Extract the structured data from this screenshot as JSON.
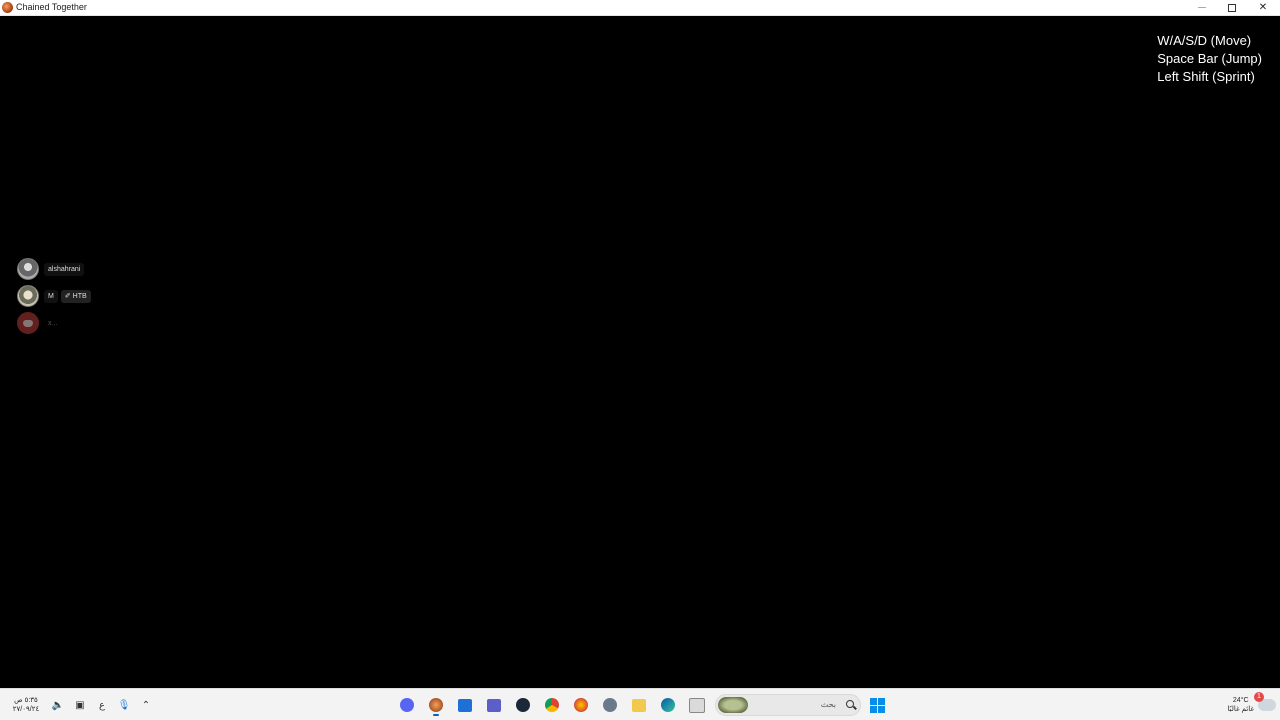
{
  "window": {
    "title": "Chained Together",
    "app_icon": "chained-together-icon"
  },
  "controls_hint": {
    "lines": [
      "W/A/S/D (Move)",
      "Space Bar (Jump)",
      "Left Shift (Sprint)"
    ],
    "color": "#ffffff"
  },
  "voice_overlay": {
    "users": [
      {
        "name": "alshahrani",
        "avatar": "user-avatar"
      },
      {
        "name": "M",
        "tag": "✐ HTB",
        "avatar": "user-avatar"
      },
      {
        "name": "x...",
        "avatar": "discord-icon"
      }
    ]
  },
  "taskbar": {
    "clock": {
      "time": "٥:٣٥ ص",
      "date": "٢٧/٠٩/٢٤"
    },
    "language": "ع",
    "search_placeholder": "بحث",
    "weather": {
      "temp": "24°C",
      "condition": "غائم غالبًا",
      "badge": "1"
    },
    "pinned_icons": [
      "discord-icon",
      "chained-together-icon",
      "store-icon",
      "teams-icon",
      "steam-icon",
      "chrome-icon",
      "firefox-icon",
      "settings-icon",
      "file-explorer-icon",
      "edge-icon",
      "task-view-icon"
    ],
    "accent": "#0067c0"
  }
}
